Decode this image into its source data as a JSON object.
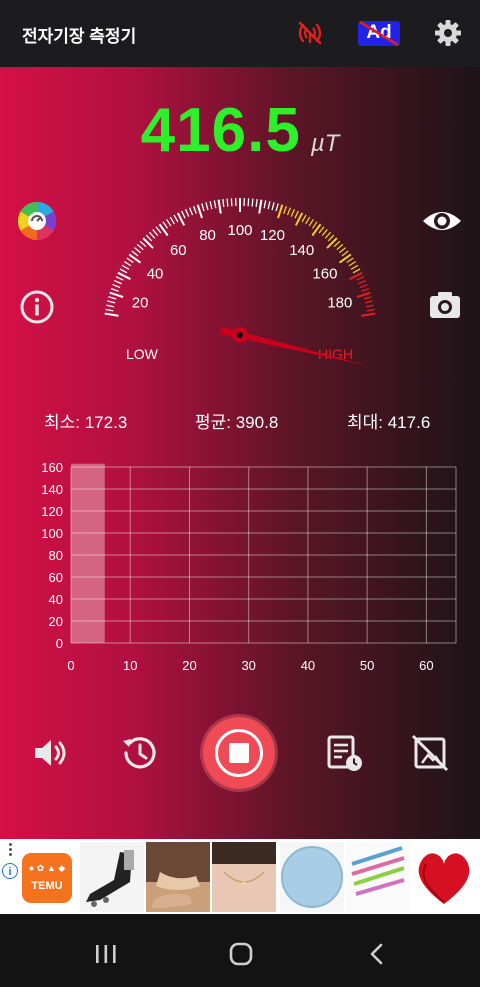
{
  "app": {
    "title": "전자기장 측정기"
  },
  "toolbar": {
    "no_signal_icon": "signal-off-icon",
    "ad_badge": "Ad",
    "settings_icon": "gear-icon"
  },
  "reading": {
    "value": "416.5",
    "unit": "µT"
  },
  "gauge": {
    "ticks": [
      "20",
      "40",
      "60",
      "80",
      "100",
      "120",
      "140",
      "160",
      "180"
    ],
    "low_label": "LOW",
    "high_label": "HIGH",
    "needle_value": 416.5
  },
  "stats": {
    "min": "최소: 172.3",
    "avg": "평균: 390.8",
    "max": "최대: 417.6"
  },
  "chart_data": {
    "type": "bar",
    "y_ticks": [
      "160",
      "140",
      "120",
      "100",
      "80",
      "60",
      "40",
      "20",
      "0"
    ],
    "x_ticks": [
      "0",
      "10",
      "20",
      "30",
      "40",
      "50",
      "60"
    ],
    "ylim": [
      0,
      160
    ],
    "xlim": [
      0,
      65
    ],
    "grid": true,
    "series": [
      {
        "x": [
          0,
          3
        ],
        "values": [
          170,
          170
        ]
      }
    ]
  },
  "side_buttons": {
    "left_top": "color-wheel-icon",
    "left_bottom": "info-icon",
    "right_top": "eye-icon",
    "right_bottom": "camera-icon"
  },
  "bottom_buttons": [
    "volume-icon",
    "history-icon",
    "record-stop-icon",
    "report-icon",
    "no-screenshot-icon"
  ],
  "ad": {
    "brand": "TEMU",
    "info": "i"
  },
  "nav": {
    "recent": "recent-apps-icon",
    "home": "home-icon",
    "back": "back-icon"
  }
}
